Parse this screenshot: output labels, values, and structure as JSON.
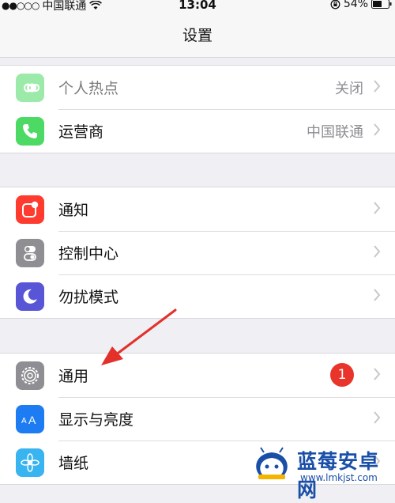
{
  "status": {
    "carrier": "中国联通",
    "time": "13:04",
    "battery": "54%"
  },
  "nav": {
    "title": "设置"
  },
  "groups": {
    "network": [
      {
        "label": "个人热点",
        "value": "关闭",
        "icon": "hotspot-icon",
        "color": "#4cd964"
      },
      {
        "label": "运营商",
        "value": "中国联通",
        "icon": "phone-icon",
        "color": "#4cd964"
      }
    ],
    "system": [
      {
        "label": "通知",
        "icon": "notification-icon",
        "color": "#ff3b30"
      },
      {
        "label": "控制中心",
        "icon": "control-center-icon",
        "color": "#8e8e93"
      },
      {
        "label": "勿扰模式",
        "icon": "moon-icon",
        "color": "#5856d6"
      }
    ],
    "general": [
      {
        "label": "通用",
        "badge": "1",
        "icon": "gear-icon",
        "color": "#8e8e93"
      },
      {
        "label": "显示与亮度",
        "icon": "display-icon",
        "color": "#1e7cf2"
      },
      {
        "label": "墙纸",
        "icon": "wallpaper-icon",
        "color": "#38b4f0"
      }
    ]
  },
  "watermark": {
    "title": "蓝莓安卓网",
    "url": "www.lmkjst.com"
  },
  "colors": {
    "accent_red": "#e8342a",
    "arrow": "#e3302a",
    "watermark": "#1a4fa8"
  }
}
